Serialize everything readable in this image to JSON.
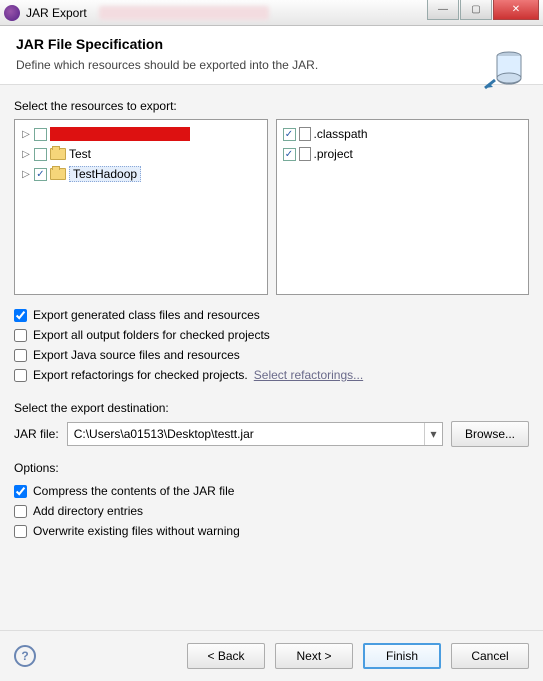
{
  "window": {
    "title": "JAR Export"
  },
  "header": {
    "title": "JAR File Specification",
    "desc": "Define which resources should be exported into the JAR."
  },
  "resources": {
    "label": "Select the resources to export:",
    "left": [
      {
        "label": "",
        "redacted": true
      },
      {
        "label": "Test"
      },
      {
        "label": "TestHadoop",
        "selected": true,
        "checked": true
      }
    ],
    "right": [
      {
        "label": ".classpath",
        "checked": true
      },
      {
        "label": ".project",
        "checked": true
      }
    ]
  },
  "exportOptions": {
    "genClass": {
      "label": "Export generated class files and resources",
      "checked": true
    },
    "outputFolders": {
      "label": "Export all output folders for checked projects",
      "checked": false
    },
    "javaSource": {
      "label": "Export Java source files and resources",
      "checked": false
    },
    "refactorings": {
      "label": "Export refactorings for checked projects.",
      "checked": false
    },
    "refactorLink": "Select refactorings..."
  },
  "destination": {
    "label": "Select the export destination:",
    "fieldLabel": "JAR file:",
    "value": "C:\\Users\\a01513\\Desktop\\testt.jar",
    "browse": "Browse..."
  },
  "options": {
    "label": "Options:",
    "compress": {
      "label": "Compress the contents of the JAR file",
      "checked": true
    },
    "addDir": {
      "label": "Add directory entries",
      "checked": false
    },
    "overwrite": {
      "label": "Overwrite existing files without warning",
      "checked": false
    }
  },
  "buttons": {
    "back": "< Back",
    "next": "Next >",
    "finish": "Finish",
    "cancel": "Cancel"
  }
}
